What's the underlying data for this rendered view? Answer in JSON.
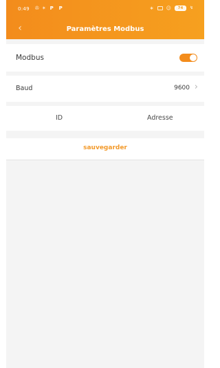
{
  "status_bar": {
    "time": "0:49",
    "left_glyphs": [
      "✇",
      "✶"
    ],
    "p1": "P",
    "p2": "P",
    "battery": "74"
  },
  "header": {
    "back_glyph": "‹",
    "title": "Paramètres Modbus"
  },
  "modbus": {
    "label": "Modbus",
    "enabled": true
  },
  "baud": {
    "label": "Baud",
    "value": "9600",
    "chevron": "›"
  },
  "table": {
    "columns": [
      "ID",
      "Adresse"
    ]
  },
  "actions": {
    "save_label": "sauvegarder"
  },
  "colors": {
    "accent": "#f38c1c",
    "save_text": "#f39a2b",
    "background": "#f4f4f4"
  }
}
